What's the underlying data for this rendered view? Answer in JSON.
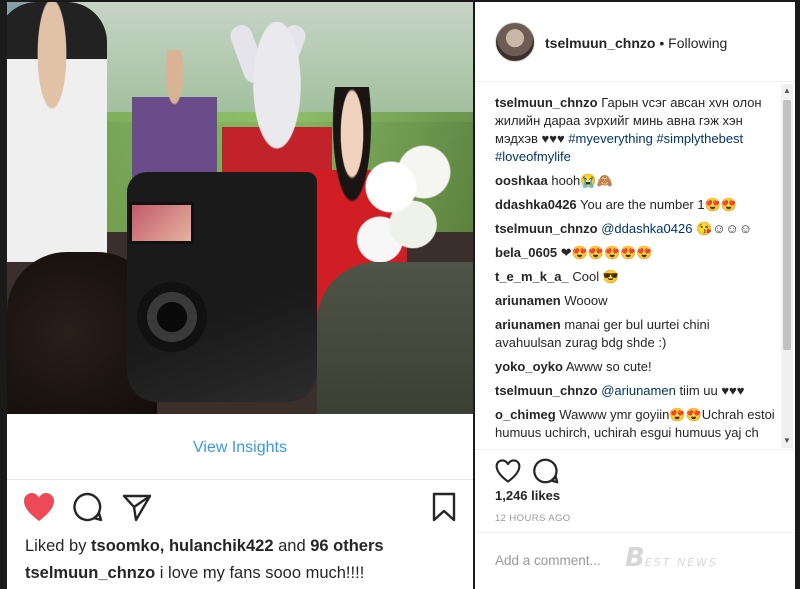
{
  "post": {
    "view_insights": "View Insights",
    "liked_by_prefix": "Liked by ",
    "liked_by_users": "tsoomko, hulanchik422",
    "liked_by_and": " and ",
    "liked_by_others": "96 others",
    "caption_user": "tselmuun_chnzo",
    "caption_text": " i love my fans sooo much!!!!"
  },
  "header": {
    "username": "tselmuun_chnzo",
    "separator": " • ",
    "follow_status": "Following"
  },
  "comments": [
    {
      "user": "tselmuun_chnzo",
      "text": " Гарын vсэг авсан хvн олон жилийн дараа зvрхийг минь авна гэж хэн мэдхэв ♥♥♥ ",
      "tags": "#myeverything #simplythebest #loveofmylife"
    },
    {
      "user": "ooshkaa",
      "text": " hooh😭🙈"
    },
    {
      "user": "ddashka0426",
      "text": " You are the number 1😍😍"
    },
    {
      "user": "tselmuun_chnzo",
      "mention": " @ddashka0426",
      "text": " 😘☺☺☺"
    },
    {
      "user": "bela_0605",
      "text": " ❤😍😍😍😍😍"
    },
    {
      "user": "t_e_m_k_a_",
      "text": " Cool 😎"
    },
    {
      "user": "ariunamen",
      "text": " Wooow"
    },
    {
      "user": "ariunamen",
      "text": " manai ger bul uurtei chini avahuulsan zurag bdg shde :)"
    },
    {
      "user": "yoko_oyko",
      "text": " Awww so cute!"
    },
    {
      "user": "tselmuun_chnzo",
      "mention": " @ariunamen",
      "text": " tiim uu ♥♥♥"
    },
    {
      "user": "o_chimeg",
      "text": " Wawww ymr goyiin😍😍Uchrah estoi humuus uchirch, uchirah esgui humuus yaj ch oroldood boldoggui gj unen"
    }
  ],
  "stats": {
    "likes": "1,246 likes",
    "time": "12 HOURS AGO"
  },
  "add_comment": {
    "placeholder": "Add a comment..."
  },
  "watermark": {
    "logo": "B",
    "text": "EST NEWS"
  },
  "colors": {
    "heart": "#ed4956",
    "link": "#3897f0",
    "mention": "#003569"
  },
  "icons": {
    "like": "heart-filled-icon",
    "comment": "comment-bubble-icon",
    "share": "paper-plane-icon",
    "save": "bookmark-icon"
  }
}
